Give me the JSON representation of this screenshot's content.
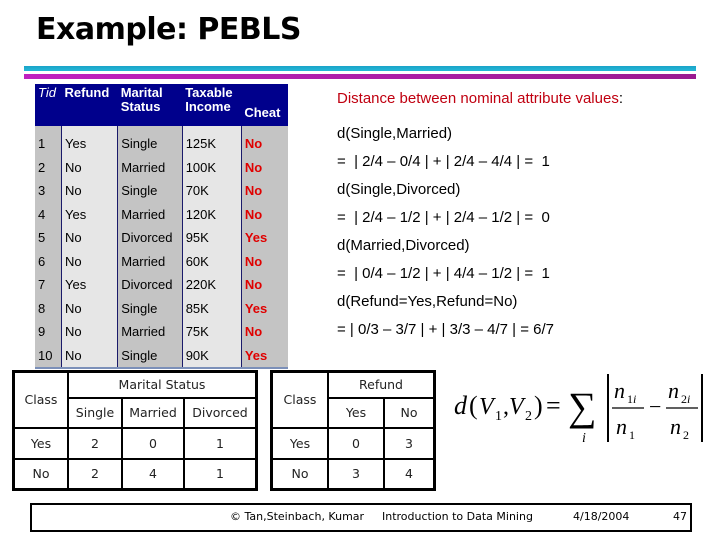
{
  "slide": {
    "title": "Example: PEBLS"
  },
  "training_table": {
    "headers": [
      "Tid",
      "Refund",
      "Marital Status",
      "Taxable Income",
      "Cheat"
    ],
    "header_lines": [
      [
        "Tid"
      ],
      [
        "Refund"
      ],
      [
        "Marital",
        "Status"
      ],
      [
        "Taxable",
        "Income"
      ],
      [
        "Cheat"
      ]
    ],
    "rows": [
      [
        "1",
        "Yes",
        "Single",
        "125K",
        "No"
      ],
      [
        "2",
        "No",
        "Married",
        "100K",
        "No"
      ],
      [
        "3",
        "No",
        "Single",
        "70K",
        "No"
      ],
      [
        "4",
        "Yes",
        "Married",
        "120K",
        "No"
      ],
      [
        "5",
        "No",
        "Divorced",
        "95K",
        "Yes"
      ],
      [
        "6",
        "No",
        "Married",
        "60K",
        "No"
      ],
      [
        "7",
        "Yes",
        "Divorced",
        "220K",
        "No"
      ],
      [
        "8",
        "No",
        "Single",
        "85K",
        "Yes"
      ],
      [
        "9",
        "No",
        "Married",
        "75K",
        "No"
      ],
      [
        "10",
        "No",
        "Single",
        "90K",
        "Yes"
      ]
    ],
    "colors": {
      "header_bg": "#00008c",
      "cheat_text": "#e00000"
    }
  },
  "distances": {
    "heading": "Distance between nominal attribute values",
    "heading_colon": ":",
    "heading_color": "#c00010",
    "lines": [
      "d(Single,Married)",
      "=  | 2/4 – 0/4 | + | 2/4 – 4/4 | =  1",
      "d(Single,Divorced)",
      "=  | 2/4 – 1/2 | + | 2/4 – 1/2 | =  0",
      "d(Married,Divorced)",
      "=  | 0/4 – 1/2 | + | 4/4 – 1/2 | =  1",
      "d(Refund=Yes,Refund=No)",
      "= | 0/3 – 3/7 | + | 3/3 – 4/7 | = 6/7"
    ]
  },
  "marital_counts": {
    "corner": "Class",
    "group": "Marital Status",
    "columns": [
      "Single",
      "Married",
      "Divorced"
    ],
    "rows": [
      {
        "label": "Yes",
        "values": [
          "2",
          "0",
          "1"
        ]
      },
      {
        "label": "No",
        "values": [
          "2",
          "4",
          "1"
        ]
      }
    ]
  },
  "refund_counts": {
    "corner": "Class",
    "group": "Refund",
    "columns": [
      "Yes",
      "No"
    ],
    "rows": [
      {
        "label": "Yes",
        "values": [
          "0",
          "3"
        ]
      },
      {
        "label": "No",
        "values": [
          "3",
          "4"
        ]
      }
    ]
  },
  "formula": {
    "lhs": "d(V1,V2) =",
    "sum_index": "i",
    "term1_num": "n1i",
    "term1_den": "n1",
    "term2_num": "n2i",
    "term2_den": "n2"
  },
  "footer": {
    "copyright": "© Tan,Steinbach, Kumar",
    "course": "Introduction to Data Mining",
    "date": "4/18/2004",
    "page": "47"
  }
}
